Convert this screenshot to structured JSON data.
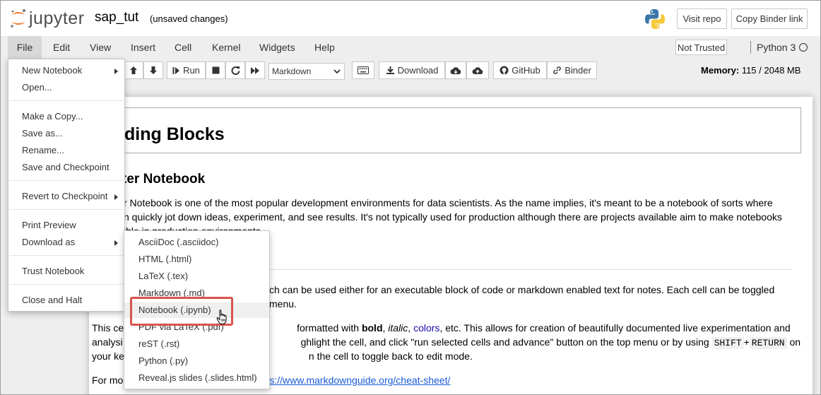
{
  "header": {
    "logo_text": "jupyter",
    "notebook_name": "sap_tut",
    "status": "(unsaved changes)",
    "visit_repo": "Visit repo",
    "copy_binder_link": "Copy Binder link"
  },
  "menubar": {
    "items": [
      "File",
      "Edit",
      "View",
      "Insert",
      "Cell",
      "Kernel",
      "Widgets",
      "Help"
    ],
    "trust_status": "Not Trusted",
    "kernel_name": "Python 3"
  },
  "toolbar": {
    "run_label": "Run",
    "cell_type": "Markdown",
    "download_label": "Download",
    "github_label": "GitHub",
    "binder_label": "Binder",
    "memory_label": "Memory:",
    "memory_value": "115 / 2048 MB"
  },
  "file_menu": {
    "items": [
      {
        "label": "New Notebook",
        "submenu": true
      },
      {
        "label": "Open..."
      },
      {
        "label": "Make a Copy..."
      },
      {
        "label": "Save as..."
      },
      {
        "label": "Rename..."
      },
      {
        "label": "Save and Checkpoint"
      },
      {
        "label": "Revert to Checkpoint",
        "submenu": true
      },
      {
        "label": "Print Preview"
      },
      {
        "label": "Download as",
        "submenu": true
      },
      {
        "label": "Trust Notebook"
      },
      {
        "label": "Close and Halt"
      }
    ]
  },
  "download_submenu": {
    "items": [
      "AsciiDoc (.asciidoc)",
      "HTML (.html)",
      "LaTeX (.tex)",
      "Markdown (.md)",
      "Notebook (.ipynb)",
      "PDF via LaTeX (.pdf)",
      "reST (.rst)",
      "Python (.py)",
      "Reveal.js slides (.slides.html)"
    ],
    "highlighted": "Notebook (.ipynb)"
  },
  "notebook": {
    "h1": "ding Blocks",
    "h2": "ter Notebook",
    "p1_line1": "r Notebook is one of the most popular development environments for data scientists. As the name implies, it's meant to be a notebook of sorts where",
    "p1_line2": "n quickly jot down ideas, experiment, and see results. It's not typically used for production although there are projects available aim to make notebooks",
    "p1_line3": "ible in production environments.",
    "p2_line1": "ch can be used either for an executable block of code or markdown enabled text for notes. Each cell can be toggled",
    "p2_line2": "menu.",
    "p3_line1_a": "This ce",
    "p3_line1_b": "formatted with ",
    "bold": "bold",
    "p3_comma1": ", ",
    "italic": "italic",
    "p3_comma2": ", ",
    "colors": "colors",
    "p3_line1_c": ", etc. This allows for creation of beautifully documented live experimentation and",
    "p3_line2_a": "analysi",
    "p3_line2_b": "ghlight the cell, and click \"run selected cells and advance\" button on the top menu or by using",
    "shift": "SHIFT",
    "plus": "+",
    "return": "RETURN",
    "on": "on",
    "p3_line3_a": "your ke",
    "p3_line3_b": "n the cell to toggle back to edit mode.",
    "p4_a": "For mo",
    "p4_link": "s://www.markdownguide.org/cheat-sheet/"
  }
}
